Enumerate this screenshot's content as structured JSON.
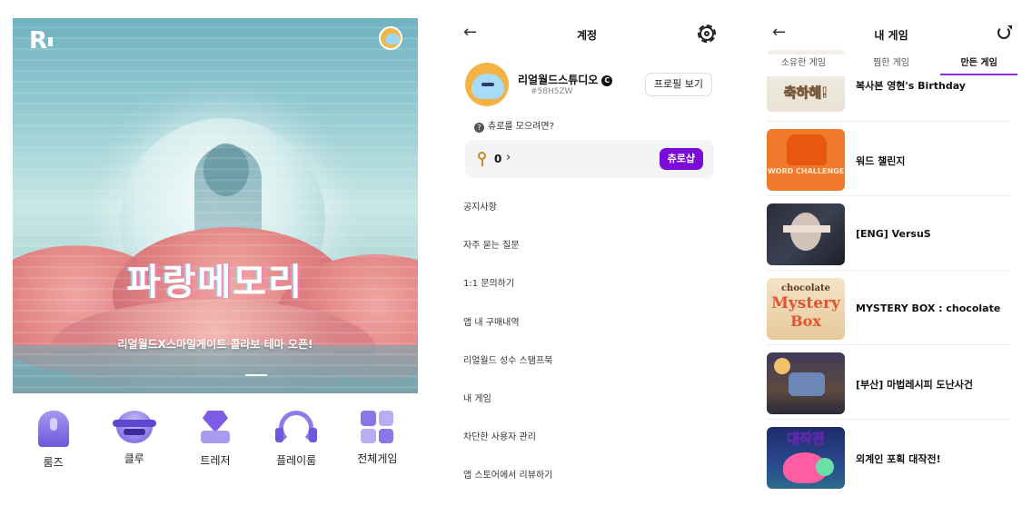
{
  "left": {
    "logo": "R",
    "banner": {
      "headline": "파랑메모리",
      "subline": "리얼월드X스마일게이트 콜라보 테마 오픈!"
    },
    "quick_menu": [
      {
        "label": "룸즈",
        "icon": "rooms-icon"
      },
      {
        "label": "클루",
        "icon": "clue-icon"
      },
      {
        "label": "트레저",
        "icon": "treasure-icon"
      },
      {
        "label": "플레이룸",
        "icon": "playroom-icon"
      },
      {
        "label": "전체게임",
        "icon": "all-games-icon"
      }
    ]
  },
  "account": {
    "title": "계정",
    "profile": {
      "name": "리얼월드스튜디오",
      "badge": "C",
      "code": "#58H5ZW",
      "view_button": "프로필 보기"
    },
    "churo_help": "츄로를 모으려면?",
    "churo_count": "0",
    "churo_shop_button": "츄로샵",
    "menu": [
      "공지사항",
      "자주 묻는 질문",
      "1:1 문의하기",
      "앱 내 구매내역",
      "리얼월드 성수 스탬프북",
      "내 게임",
      "차단한 사용자 관리",
      "앱 스토어에서 리뷰하기"
    ]
  },
  "my_games": {
    "title": "내 게임",
    "tabs": [
      "소유한 게임",
      "찜한 게임",
      "만든 게임"
    ],
    "active_tab": "만든 게임",
    "games": [
      {
        "title": "복사본 영현's Birthday",
        "thumb_text": "축하해!"
      },
      {
        "title": "워드 챌린지",
        "thumb_text": "WORD CHALLENGE"
      },
      {
        "title": "[ENG] VersuS",
        "thumb_text": ""
      },
      {
        "title": "MYSTERY BOX : chocolate",
        "thumb_text_a": "chocolate",
        "thumb_text_b": "Mystery",
        "thumb_text_c": "Box"
      },
      {
        "title": "[부산] 마법레시피 도난사건",
        "thumb_text": ""
      },
      {
        "title": "외계인 포획 대작전!",
        "thumb_text": "대작전"
      }
    ]
  },
  "colors": {
    "accent": "#7a0bd9",
    "tab_underline": "#8a2be2",
    "quick_icons": "#8a76e6"
  }
}
